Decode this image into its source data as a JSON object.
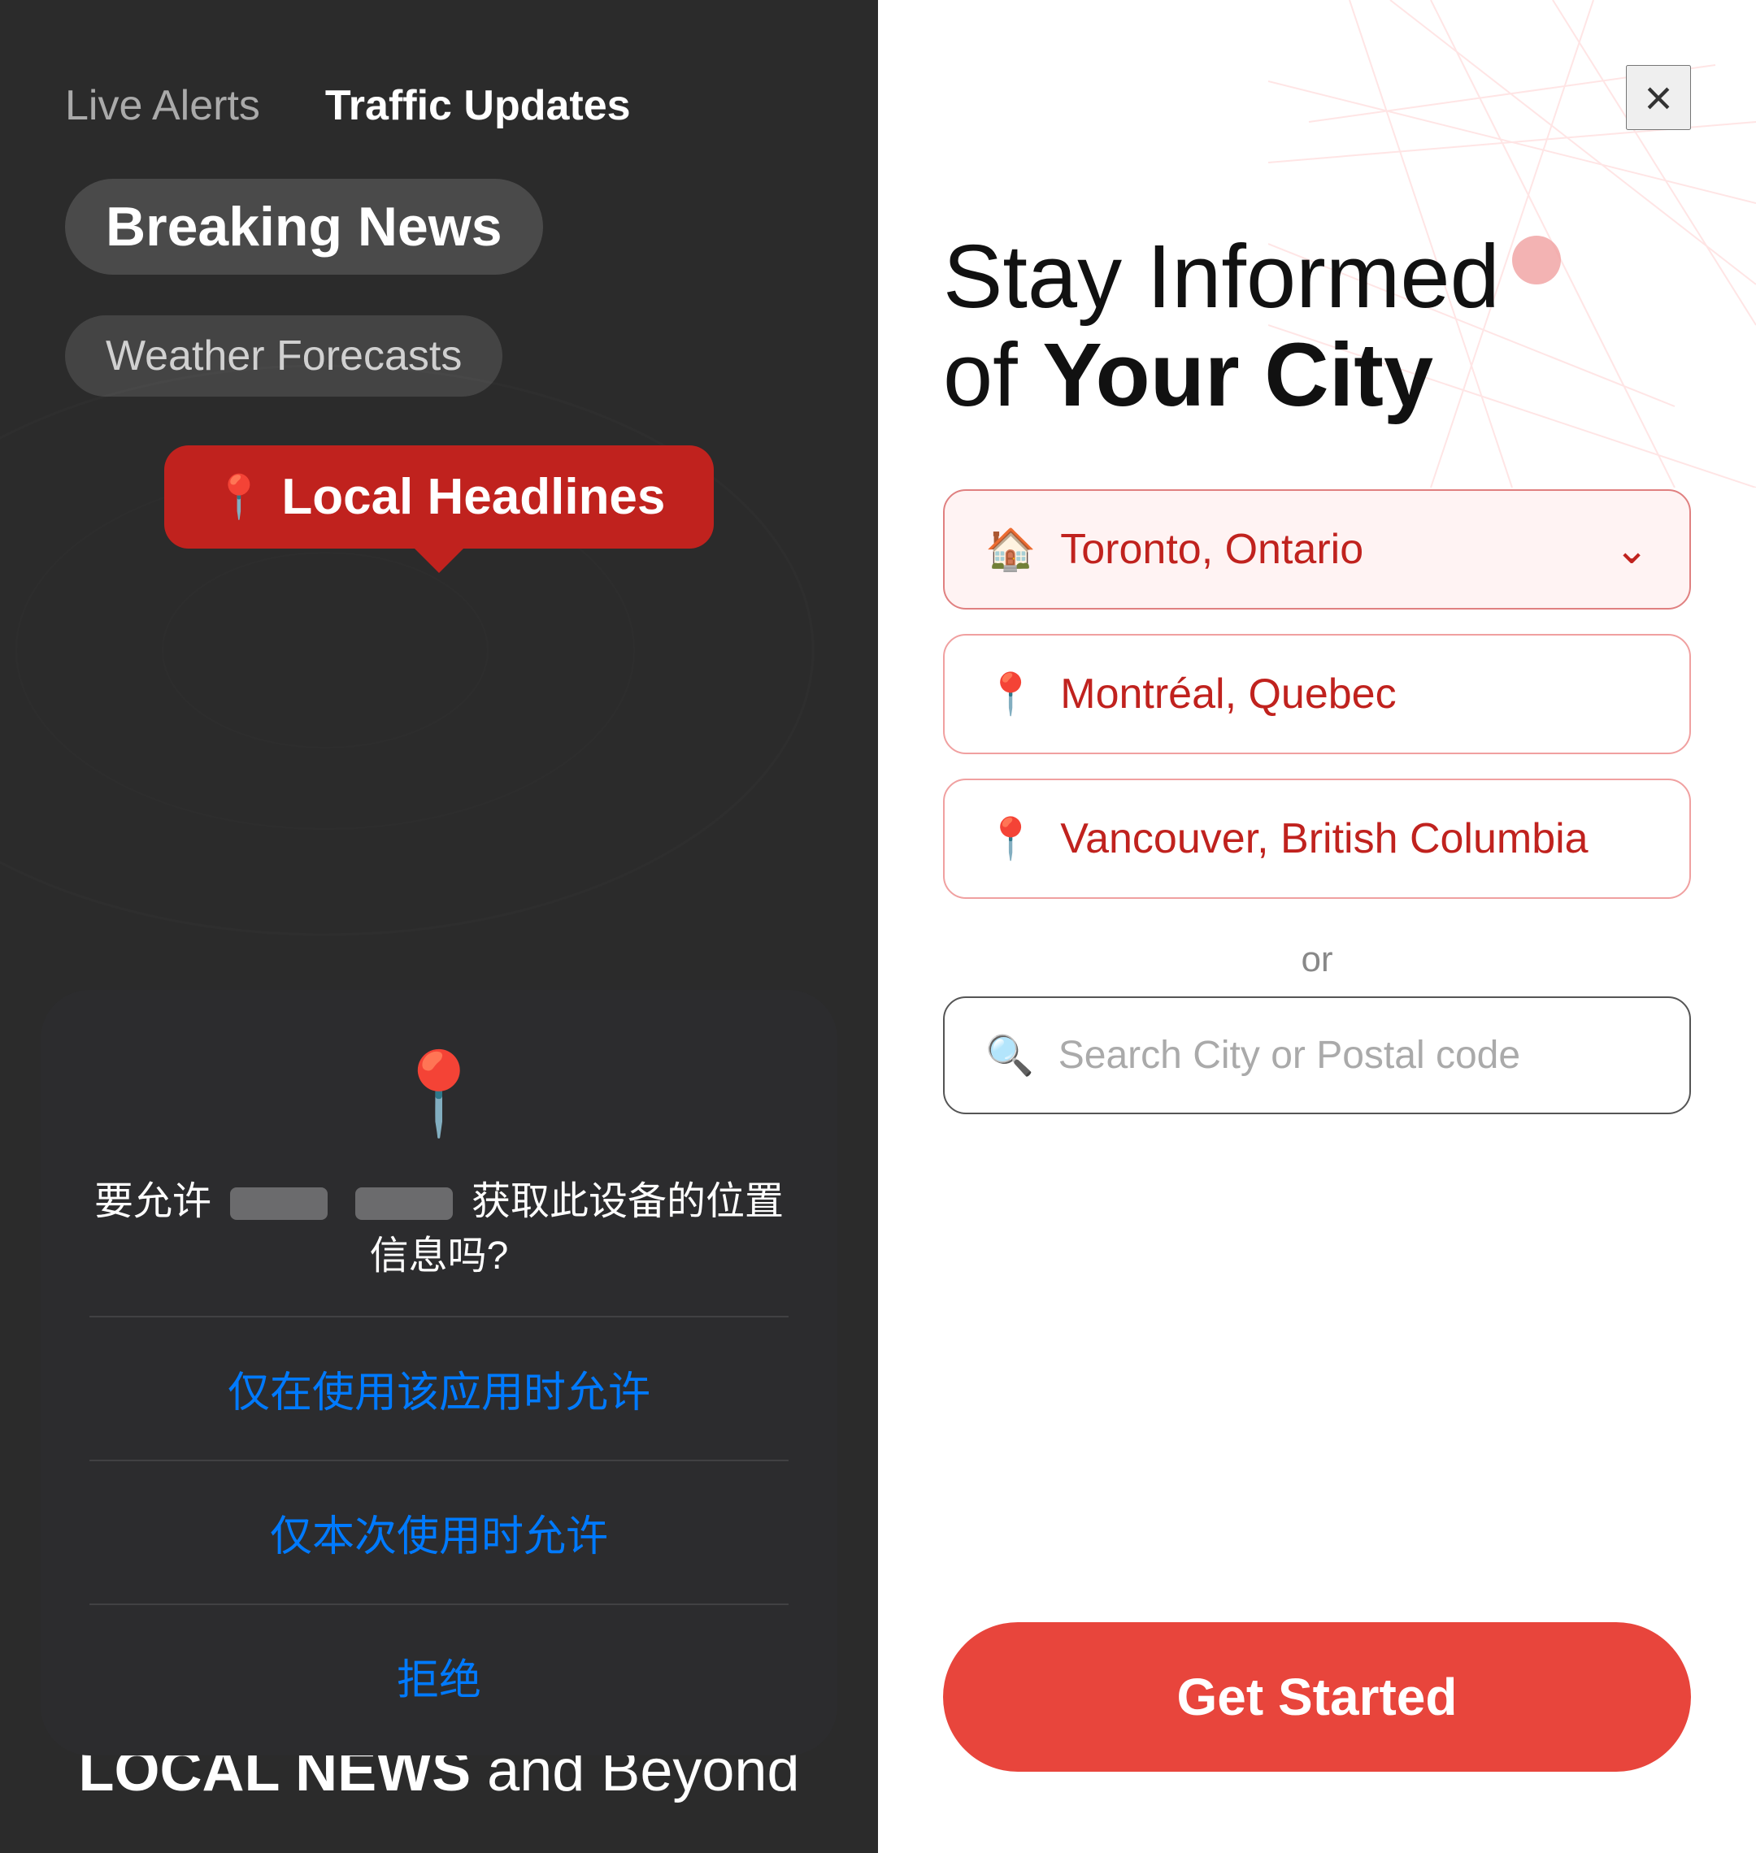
{
  "left": {
    "nav_tabs": [
      {
        "label": "Live Alerts",
        "active": false
      },
      {
        "label": "Traffic Updates",
        "active": true
      }
    ],
    "pills": [
      {
        "label": "Breaking News",
        "type": "primary"
      },
      {
        "label": "Weather Forecasts",
        "type": "secondary"
      }
    ],
    "local_headlines_badge": {
      "label": "Local Headlines",
      "pin_icon": "📍"
    },
    "tagline": {
      "prefix": "",
      "strong": "LOCAL NEWS",
      "suffix": " and Beyond"
    },
    "dialog": {
      "pin_icon": "📍",
      "question": "要允许  获取此设备的位置信息吗?",
      "buttons": [
        {
          "label": "仅在使用该应用时允许"
        },
        {
          "label": "仅本次使用时允许"
        },
        {
          "label": "拒绝"
        }
      ]
    }
  },
  "right": {
    "close_button": "×",
    "hero": {
      "line1": "Stay Informed",
      "line2_prefix": "of ",
      "line2_bold": "Your City"
    },
    "cities": [
      {
        "name": "Toronto, Ontario",
        "selected": true,
        "has_chevron": true,
        "icon": "🏠"
      },
      {
        "name": "Montréal, Quebec",
        "selected": false,
        "has_chevron": false,
        "icon": "📍"
      },
      {
        "name": "Vancouver, British Columbia",
        "selected": false,
        "has_chevron": false,
        "icon": "📍"
      }
    ],
    "or_label": "or",
    "search": {
      "placeholder": "Search City or Postal code",
      "icon": "🔍"
    },
    "get_started_btn": "Get Started"
  }
}
